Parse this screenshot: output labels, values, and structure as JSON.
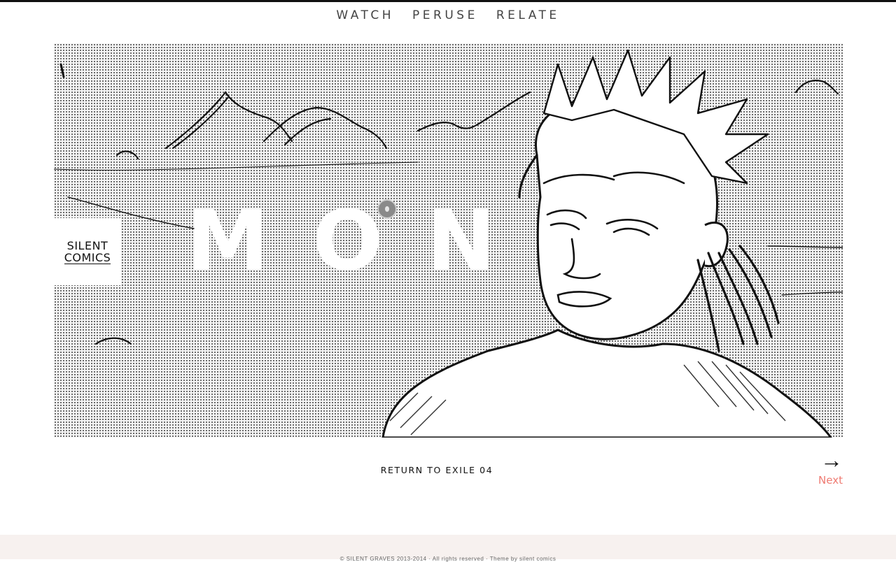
{
  "nav": {
    "items": [
      "WATCH",
      "PERUSE",
      "RELATE"
    ]
  },
  "hero": {
    "badge": {
      "line1": "SILENT",
      "line2": "COMICS"
    },
    "title": "MON"
  },
  "pager": {
    "return_label": "RETURN TO EXILE 04",
    "next_arrow": "→",
    "next_label": "Next"
  },
  "footer": {
    "text": "© SILENT GRAVES 2013-2014 · All rights reserved · Theme by silent comics"
  },
  "colors": {
    "accent": "#ef7b72",
    "text": "#111111",
    "nav": "#444444",
    "footer_bg": "#f7f1ef"
  }
}
